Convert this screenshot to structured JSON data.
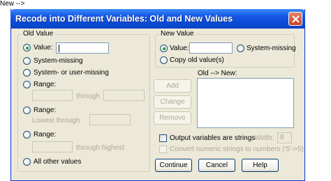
{
  "window": {
    "title": "Recode into Different Variables: Old and New Values"
  },
  "old_value": {
    "legend": "Old Value",
    "value_label": "Value:",
    "value_input": "",
    "system_missing": "System-missing",
    "system_or_user_missing": "System- or user-missing",
    "range1_label": "Range:",
    "range1_through": "through",
    "range2_label": "Range:",
    "range2_lowest": "Lowest through",
    "range3_label": "Range:",
    "range3_highest": "through highest",
    "all_other": "All other values",
    "selected": "value"
  },
  "new_value": {
    "legend": "New Value",
    "value_label": "Value:",
    "value_input": "",
    "system_missing": "System-missing",
    "copy_old": "Copy old value(s)",
    "selected": "value"
  },
  "mapping": {
    "label": "Old --> New:",
    "add": "Add",
    "change": "Change",
    "remove": "Remove"
  },
  "options": {
    "output_strings": "Output variables are strings",
    "width_label": "Width:",
    "width_value": "8",
    "convert_numeric": "Convert numeric strings to numbers ('5'->5)"
  },
  "buttons": {
    "continue": "Continue",
    "cancel": "Cancel",
    "help": "Help"
  }
}
